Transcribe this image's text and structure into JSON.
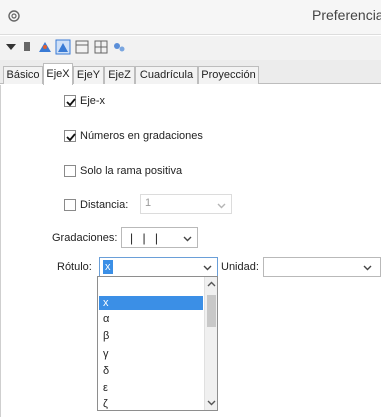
{
  "window": {
    "title": "Preferencias"
  },
  "tabs": [
    {
      "label": "Básico"
    },
    {
      "label": "EjeX",
      "active": true
    },
    {
      "label": "EjeY"
    },
    {
      "label": "EjeZ"
    },
    {
      "label": "Cuadrícula"
    },
    {
      "label": "Proyección"
    }
  ],
  "toolbar_icons": [
    "arrow-down-icon",
    "pin-icon",
    "graphics-icon",
    "graphics-3d-icon",
    "view-panel-icon",
    "grid-icon",
    "settings-icon"
  ],
  "axis": {
    "eje_x": {
      "label": "Eje-x",
      "checked": true
    },
    "numeros": {
      "label": "Números en gradaciones",
      "checked": true
    },
    "rama_positiva": {
      "label": "Solo la rama positiva",
      "checked": false
    },
    "distancia": {
      "label": "Distancia:",
      "checked": false,
      "value": "1"
    },
    "gradaciones": {
      "label": "Gradaciones:",
      "value": "| | |"
    },
    "rotulo": {
      "label": "Rótulo:",
      "value": "x"
    },
    "unidad": {
      "label": "Unidad:",
      "value": ""
    }
  },
  "rotulo_options": [
    "",
    "x",
    "α",
    "β",
    "γ",
    "δ",
    "ε",
    "ζ"
  ],
  "rotulo_selected_index": 1,
  "colors": {
    "accent": "#3b8fe6",
    "tab_border": "#bdbdbd"
  }
}
